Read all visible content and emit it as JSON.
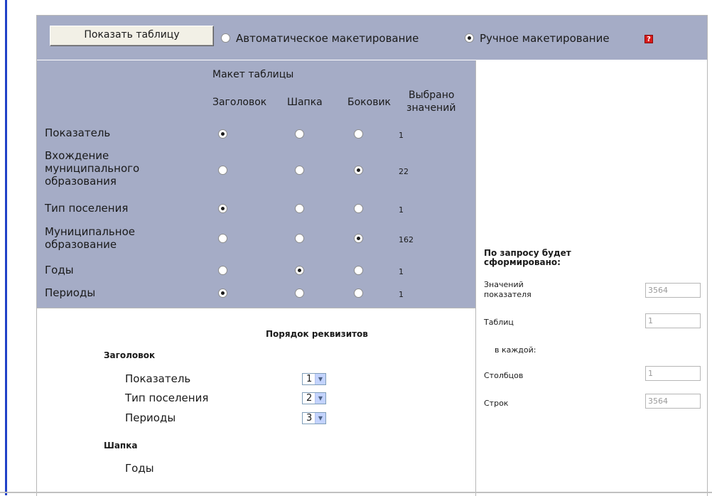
{
  "toolbar": {
    "show_table_label": "Показать таблицу",
    "auto_layout_label": "Автоматическое макетирование",
    "manual_layout_label": "Ручное макетирование",
    "help_label": "?",
    "selected_mode": "manual"
  },
  "layout": {
    "title": "Макет таблицы",
    "columns": [
      "Заголовок",
      "Шапка",
      "Боковик"
    ],
    "count_header_line1": "Выбрано",
    "count_header_line2": "значений",
    "rows": [
      {
        "label": "Показатель",
        "selected": "Заголовок",
        "count": "1"
      },
      {
        "label": "Вхождение муниципального образования",
        "label_lines": [
          "Вхождение",
          "муниципального",
          "образования"
        ],
        "selected": "Боковик",
        "count": "22"
      },
      {
        "label": "Тип поселения",
        "selected": "Заголовок",
        "count": "1"
      },
      {
        "label": "Муниципальное образование",
        "label_lines": [
          "Муниципальное",
          "образование"
        ],
        "selected": "Боковик",
        "count": "162"
      },
      {
        "label": "Годы",
        "selected": "Шапка",
        "count": "1"
      },
      {
        "label": "Периоды",
        "selected": "Заголовок",
        "count": "1"
      }
    ]
  },
  "order": {
    "title": "Порядок реквизитов",
    "header_section": "Заголовок",
    "header_items": [
      {
        "label": "Показатель",
        "order": "1"
      },
      {
        "label": "Тип поселения",
        "order": "2"
      },
      {
        "label": "Периоды",
        "order": "3"
      }
    ],
    "cap_section": "Шапка",
    "cap_items": [
      "Годы"
    ]
  },
  "summary": {
    "title_line1": "По запросу будет",
    "title_line2": "сформировано:",
    "values_label_line1": "Значений",
    "values_label_line2": "показателя",
    "values_count": "3564",
    "tables_label": "Таблиц",
    "tables_count": "1",
    "each_label": "в каждой:",
    "columns_label": "Столбцов",
    "columns_count": "1",
    "rows_label": "Строк",
    "rows_count": "3564"
  },
  "colors": {
    "panel_bg": "#a5acc6",
    "accent_bar": "#2141c8",
    "help_icon": "#d81a1a",
    "select_arrow_bg": "#c3d3fd"
  }
}
